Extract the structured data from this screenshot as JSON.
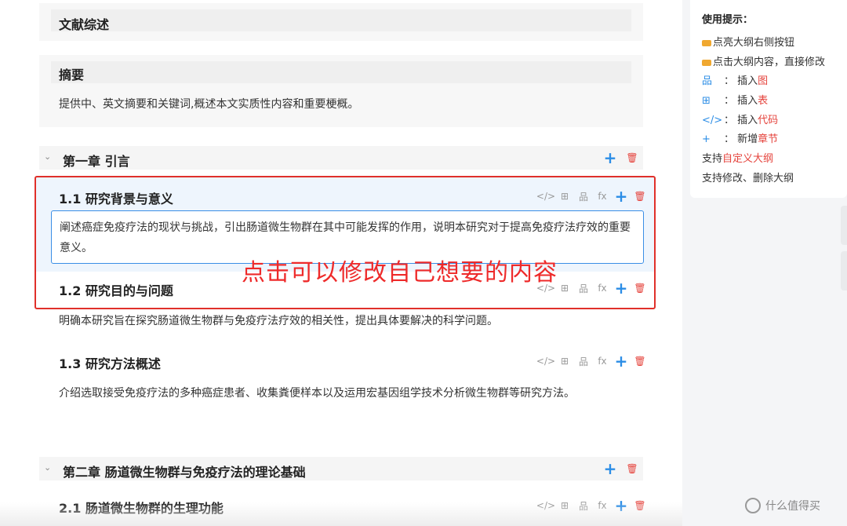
{
  "lit_review": {
    "title": "文献综述"
  },
  "abstract": {
    "title": "摘要",
    "body": "提供中、英文摘要和关键词,概述本文实质性内容和重要梗概。"
  },
  "chapter1": {
    "title": "第一章 引言",
    "sections": [
      {
        "title": "1.1 研究背景与意义",
        "body": "阐述癌症免疫疗法的现状与挑战，引出肠道微生物群在其中可能发挥的作用，说明本研究对于提高免疫疗法疗效的重要意义。"
      },
      {
        "title": "1.2 研究目的与问题",
        "body": "明确本研究旨在探究肠道微生物群与免疫疗法疗效的相关性，提出具体要解决的科学问题。"
      },
      {
        "title": "1.3 研究方法概述",
        "body": "介绍选取接受免疫疗法的多种癌症患者、收集粪便样本以及运用宏基因组学技术分析微生物群等研究方法。"
      }
    ]
  },
  "chapter2": {
    "title": "第二章 肠道微生物群与免疫疗法的理论基础",
    "sections": [
      {
        "title": "2.1 肠道微生物群的生理功能"
      }
    ]
  },
  "annotation": "点击可以修改自己想要的内容",
  "action_icons": {
    "code": "</>",
    "table": "⊞",
    "tree": "品",
    "formula": "fx",
    "plus": "+",
    "trash": "🗑"
  },
  "tips": {
    "title": "使用提示：",
    "line1": "点亮大纲右侧按钮",
    "line2": "点击大纲内容，直接修改",
    "line3_pre": "：  插入",
    "line3_red": "图",
    "line4_pre": "：  插入",
    "line4_red": "表",
    "line5_pre": "：  插入",
    "line5_red": "代码",
    "line6_pre": "：  新增",
    "line6_red": "章节",
    "line7_pre": "支持",
    "line7_red": "自定义大纲",
    "line8": "支持修改、删除大纲",
    "icon_tree": "品",
    "icon_table": "⊞",
    "icon_code": "</>",
    "icon_plus": "+"
  },
  "watermark": "什么值得买",
  "colors": {
    "accent": "#2b8de6",
    "danger": "#e5433c",
    "annotation": "#ee2a2a"
  }
}
